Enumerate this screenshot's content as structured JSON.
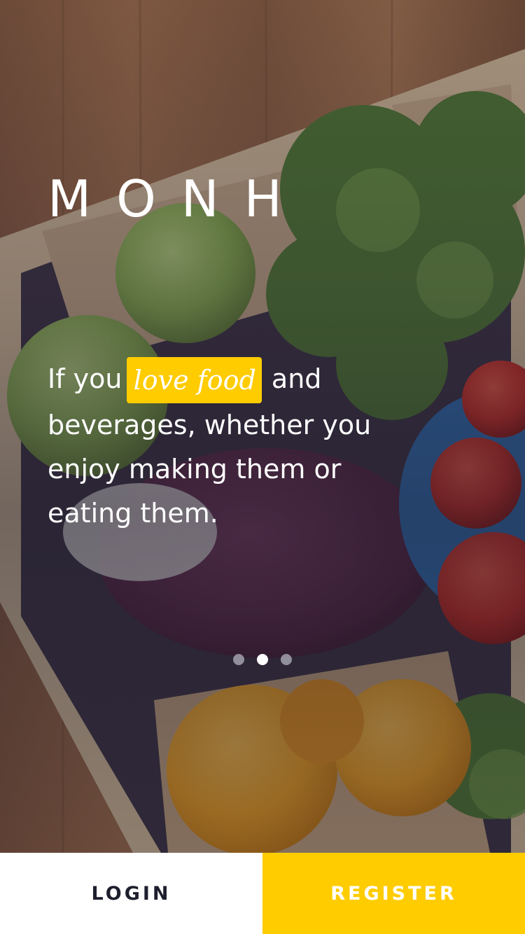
{
  "brand": {
    "logo_text": "MONH"
  },
  "tagline": {
    "before": "If you",
    "highlight": "love food",
    "after": "and beverages, whether you enjoy making them or eating them."
  },
  "pager": {
    "total": 3,
    "active_index": 1
  },
  "actions": {
    "login_label": "LOGIN",
    "register_label": "REGISTER"
  },
  "colors": {
    "accent": "#ffcc00",
    "login_bg": "#ffffff",
    "login_text": "#1e1f2e",
    "register_text": "#ffffff"
  }
}
